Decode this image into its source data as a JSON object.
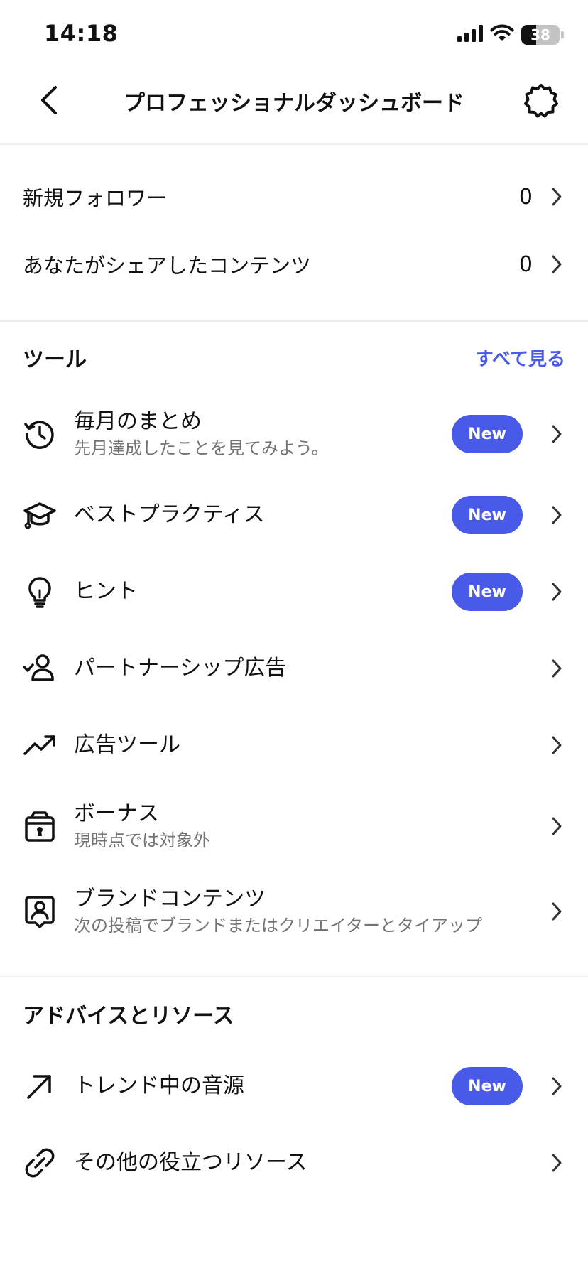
{
  "status_bar": {
    "time": "14:18",
    "battery_level": "38"
  },
  "header": {
    "title": "プロフェッショナルダッシュボード"
  },
  "stats": [
    {
      "label": "新規フォロワー",
      "value": "0"
    },
    {
      "label": "あなたがシェアしたコンテンツ",
      "value": "0"
    }
  ],
  "tools": {
    "title": "ツール",
    "see_all": "すべて見る",
    "items": [
      {
        "title": "毎月のまとめ",
        "subtitle": "先月達成したことを見てみよう。",
        "badge": "New",
        "icon": "history-icon"
      },
      {
        "title": "ベストプラクティス",
        "badge": "New",
        "icon": "graduation-cap-icon"
      },
      {
        "title": "ヒント",
        "badge": "New",
        "icon": "lightbulb-icon"
      },
      {
        "title": "パートナーシップ広告",
        "icon": "person-check-icon"
      },
      {
        "title": "広告ツール",
        "icon": "trending-up-icon"
      },
      {
        "title": "ボーナス",
        "subtitle": "現時点では対象外",
        "icon": "gift-box-icon"
      },
      {
        "title": "ブランドコンテンツ",
        "subtitle": "次の投稿でブランドまたはクリエイターとタイアップ",
        "icon": "branded-content-icon"
      }
    ]
  },
  "resources": {
    "title": "アドバイスとリソース",
    "items": [
      {
        "title": "トレンド中の音源",
        "badge": "New",
        "icon": "arrow-up-right-icon"
      },
      {
        "title": "その他の役立つリソース",
        "icon": "link-icon"
      }
    ]
  },
  "colors": {
    "accent": "#4a5ae8",
    "text": "#111111",
    "secondary_text": "#737373",
    "divider": "#efefef"
  }
}
